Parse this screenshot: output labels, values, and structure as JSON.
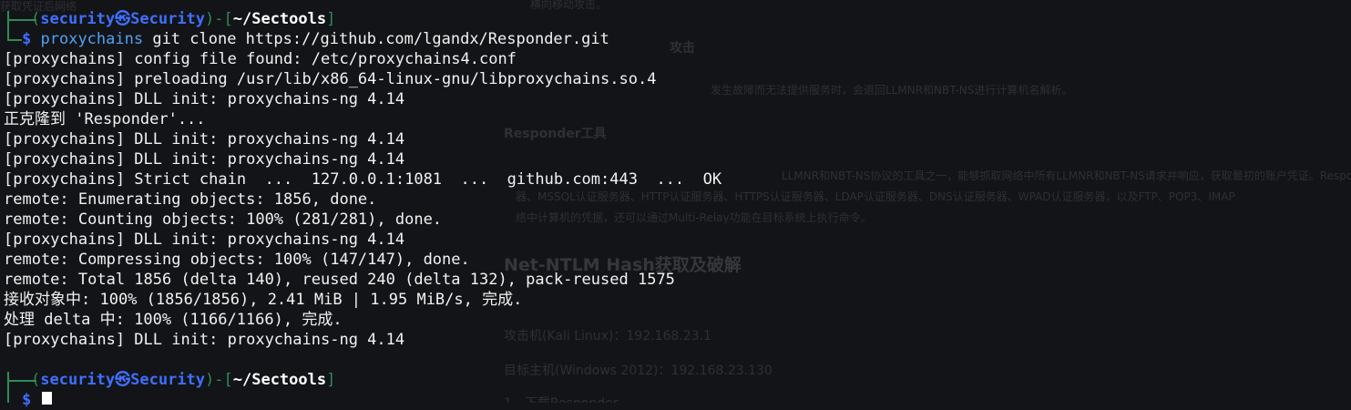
{
  "terminal": {
    "prompt1": {
      "user": "security",
      "at_symbol": "㉿",
      "host": "Security",
      "cwd": "~/Sectools",
      "dollar": "$",
      "command_tool": "proxychains",
      "command_args": " git clone https://github.com/lgandx/Responder.git"
    },
    "output_lines": [
      "[proxychains] config file found: /etc/proxychains4.conf",
      "[proxychains] preloading /usr/lib/x86_64-linux-gnu/libproxychains.so.4",
      "[proxychains] DLL init: proxychains-ng 4.14",
      "正克隆到 'Responder'...",
      "[proxychains] DLL init: proxychains-ng 4.14",
      "[proxychains] DLL init: proxychains-ng 4.14",
      "[proxychains] Strict chain  ...  127.0.0.1:1081  ...  github.com:443  ...  OK",
      "remote: Enumerating objects: 1856, done.",
      "remote: Counting objects: 100% (281/281), done.",
      "[proxychains] DLL init: proxychains-ng 4.14",
      "remote: Compressing objects: 100% (147/147), done.",
      "remote: Total 1856 (delta 140), reused 240 (delta 132), pack-reused 1575",
      "接收对象中: 100% (1856/1856), 2.41 MiB | 1.95 MiB/s, 完成.",
      "处理 delta 中: 100% (1166/1166), 完成.",
      "[proxychains] DLL init: proxychains-ng 4.14"
    ],
    "prompt2": {
      "user": "security",
      "at_symbol": "㉿",
      "host": "Security",
      "cwd": "~/Sectools",
      "dollar": "$"
    }
  },
  "background_document": {
    "top_fragment": "横向移动攻击。",
    "section_fragment": "攻击",
    "dns_fail_text": "发生故障而无法提供服务时，会退回LLMNR和NBT-NS进行计算机名解析。",
    "responder_heading": "Responder工具",
    "responder_desc1": "LLMNR和NBT-NS协议的工具之一，能够抓取网络中所有LLMNR和NBT-NS请求并响应，获取最初的账户凭证。Respo",
    "responder_desc2": "器、MSSQL认证服务器、HTTP认证服务器、HTTPS认证服务器、LDAP认证服务器、DNS认证服务器、WPAD认证服务器，以及FTP、POP3、IMAP",
    "responder_desc3": "络中计算机的凭据，还可以通过Multi-Relay功能在目标系统上执行命令。",
    "ntlm_heading": "Net-NTLM Hash获取及破解",
    "attacker_line": "攻击机(Kali Linux)：192.168.23.1",
    "target_line": "目标主机(Windows 2012)：192.168.23.130",
    "download_line": "1、下载Responder",
    "corner_fragment": "获取凭证后网络"
  }
}
